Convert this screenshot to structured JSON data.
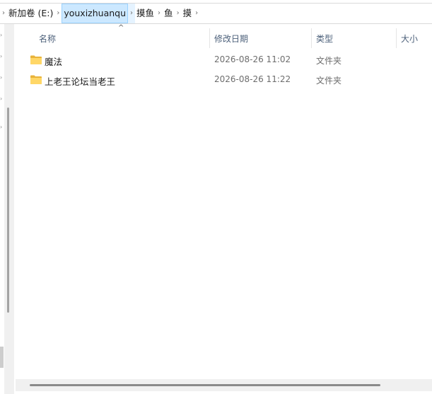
{
  "breadcrumb": {
    "items": [
      {
        "label": "新加卷 (E:)"
      },
      {
        "label": "youxizhuanqu"
      },
      {
        "label": "摸鱼"
      },
      {
        "label": "鱼"
      },
      {
        "label": "摸"
      }
    ]
  },
  "columns": {
    "name": "名称",
    "date": "修改日期",
    "type": "类型",
    "size": "大小",
    "sort_indicator": "^"
  },
  "files": [
    {
      "name": "魔法",
      "date": "2026-08-26 11:02",
      "type": "文件夹",
      "icon": "folder-icon"
    },
    {
      "name": "上老王论坛当老王",
      "date": "2026-08-26 11:22",
      "type": "文件夹",
      "icon": "folder-icon"
    }
  ],
  "colors": {
    "selected_crumb_bg": "#cce8ff",
    "folder_yellow": "#ffd767",
    "column_header_text": "#4c607a"
  }
}
